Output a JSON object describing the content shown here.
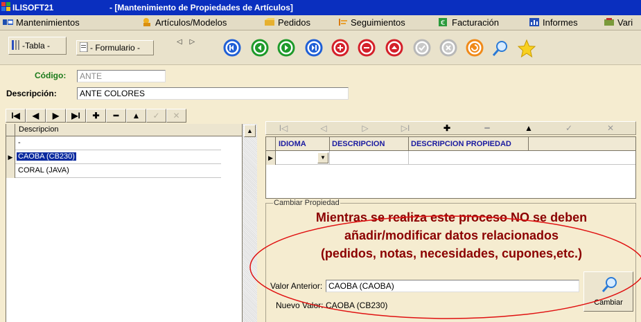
{
  "window": {
    "app_title": "ILISOFT21",
    "title": "- [Mantenimiento de Propiedades de Artículos]"
  },
  "menubar": {
    "items": [
      {
        "label": "Mantenimientos",
        "icon": "tools-icon"
      },
      {
        "label": "Artículos/Modelos",
        "icon": "articles-icon"
      },
      {
        "label": "Pedidos",
        "icon": "orders-icon"
      },
      {
        "label": "Seguimientos",
        "icon": "tracking-icon"
      },
      {
        "label": "Facturación",
        "icon": "invoice-icon"
      },
      {
        "label": "Informes",
        "icon": "reports-icon"
      },
      {
        "label": "Vari",
        "icon": "misc-icon"
      }
    ]
  },
  "toolbar": {
    "tab_tabla": "-Tabla -",
    "tab_formulario": "- Formulario -",
    "scroll_arrows": "◁ ▷",
    "buttons": [
      {
        "name": "first-record-button",
        "color": "#1f5fd6",
        "glyph": "first"
      },
      {
        "name": "prev-record-button",
        "color": "#1e9a2a",
        "glyph": "prev"
      },
      {
        "name": "next-record-button",
        "color": "#1e9a2a",
        "glyph": "next"
      },
      {
        "name": "last-record-button",
        "color": "#1f5fd6",
        "glyph": "last"
      },
      {
        "name": "add-record-button",
        "color": "#d4202a",
        "glyph": "plus"
      },
      {
        "name": "delete-record-button",
        "color": "#d4202a",
        "glyph": "minus"
      },
      {
        "name": "edit-record-button",
        "color": "#d4202a",
        "glyph": "up"
      },
      {
        "name": "confirm-button",
        "color": "#b8b8b8",
        "glyph": "check"
      },
      {
        "name": "cancel-button",
        "color": "#b8b8b8",
        "glyph": "x"
      },
      {
        "name": "refresh-button",
        "color": "#f08a1a",
        "glyph": "refresh"
      },
      {
        "name": "search-button",
        "color": "#2a7ad6",
        "glyph": "search"
      },
      {
        "name": "favorite-button",
        "color": "#f4c400",
        "glyph": "star"
      }
    ]
  },
  "form": {
    "codigo_label": "Código:",
    "codigo_value": "ANTE",
    "descripcion_label": "Descripción:",
    "descripcion_value": "ANTE COLORES"
  },
  "left_grid": {
    "nav_buttons": [
      "I◀",
      "◀",
      "▶",
      "▶I",
      "✚",
      "━",
      "▲",
      "✓",
      "✕"
    ],
    "column_header": "Descripcion",
    "rows": [
      {
        "value": "-",
        "selected": false,
        "current": false
      },
      {
        "value": "CAOBA (CB230)",
        "selected": true,
        "current": true
      },
      {
        "value": "CORAL (JAVA)",
        "selected": false,
        "current": false
      }
    ]
  },
  "right_grid": {
    "nav_buttons": [
      "I◁",
      "◁",
      "▷",
      "▷I",
      "✚",
      "━",
      "▲",
      "✓",
      "✕"
    ],
    "headers": [
      "IDIOMA",
      "DESCRIPCION",
      "DESCRIPCION PROPIEDAD"
    ]
  },
  "cambiar": {
    "legend": "Cambiar Propiedad",
    "warning_lines": [
      "Mientras se realiza este proceso NO se deben",
      "añadir/modificar datos relacionados",
      "(pedidos, notas, necesidades, cupones,etc.)"
    ],
    "valor_anterior_label": "Valor Anterior:",
    "valor_anterior_value": "CAOBA (CAOBA)",
    "nuevo_valor_label": "Nuevo Valor:",
    "nuevo_valor_value": "CAOBA (CB230)",
    "button_label": "Cambiar",
    "ellipse_color": "#e01010",
    "warning_color": "#8b0000"
  },
  "colors": {
    "title_bar": "#0a2fbf",
    "selection": "#0a2a9f",
    "background": "#f5ecd0"
  }
}
